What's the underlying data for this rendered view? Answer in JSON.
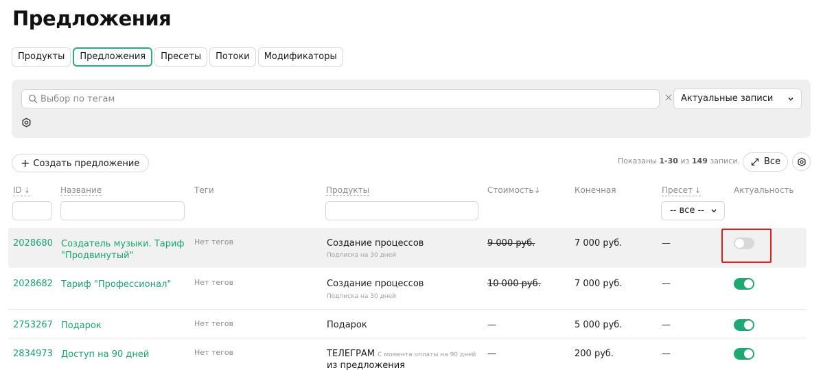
{
  "page": {
    "title": "Предложения"
  },
  "tabs": [
    {
      "label": "Продукты",
      "active": false
    },
    {
      "label": "Предложения",
      "active": true
    },
    {
      "label": "Пресеты",
      "active": false
    },
    {
      "label": "Потоки",
      "active": false
    },
    {
      "label": "Модификаторы",
      "active": false
    }
  ],
  "filters": {
    "tag_search_placeholder": "Выбор по тегам",
    "status_value": "Актуальные записи"
  },
  "toolbar": {
    "create_label": "Создать предложение",
    "records_prefix": "Показаны ",
    "records_range": "1-30",
    "records_middle": " из ",
    "records_total": "149",
    "records_suffix": " записи.",
    "all_label": "Все"
  },
  "columns": {
    "id": "ID",
    "id_arrow": "↓",
    "name": "Название",
    "tags": "Теги",
    "products": "Продукты",
    "price": "Стоимость",
    "price_arrow": "↓",
    "final": "Конечная",
    "preset": "Пресет",
    "preset_arrow": "↓",
    "active": "Актуальность"
  },
  "preset_filter": {
    "value": "-- все --"
  },
  "rows": [
    {
      "id": "2028680",
      "name": "Создатель музыки. Тариф \"Продвинутый\"",
      "tags": "Нет тегов",
      "product": "Создание процессов",
      "product_sub": "Подписка на 30 дней",
      "price": "9 000 руб.",
      "final": "7 000 руб.",
      "preset": "—",
      "active": false
    },
    {
      "id": "2028682",
      "name": "Тариф \"Профессионал\"",
      "tags": "Нет тегов",
      "product": "Создание процессов",
      "product_sub": "Подписка на 30 дней",
      "price": "10 000 руб.",
      "final": "7 000 руб.",
      "preset": "—",
      "active": true
    },
    {
      "id": "2753267",
      "name": "Подарок",
      "tags": "Нет тегов",
      "product": "Подарок",
      "product_sub": "",
      "price": "—",
      "final": "5 000 руб.",
      "preset": "—",
      "active": true
    },
    {
      "id": "2834973",
      "name": "Доступ на 90 дней",
      "tags": "Нет тегов",
      "product": "ТЕЛЕГРАМ",
      "product_inline_sub": "С момента оплаты на 90 дней",
      "product_line2": "из предложения",
      "price": "—",
      "final": "200 руб.",
      "preset": "—",
      "active": true
    }
  ],
  "colors": {
    "accent": "#1fa874",
    "link": "#17a46d",
    "highlight_frame": "#e02020"
  }
}
